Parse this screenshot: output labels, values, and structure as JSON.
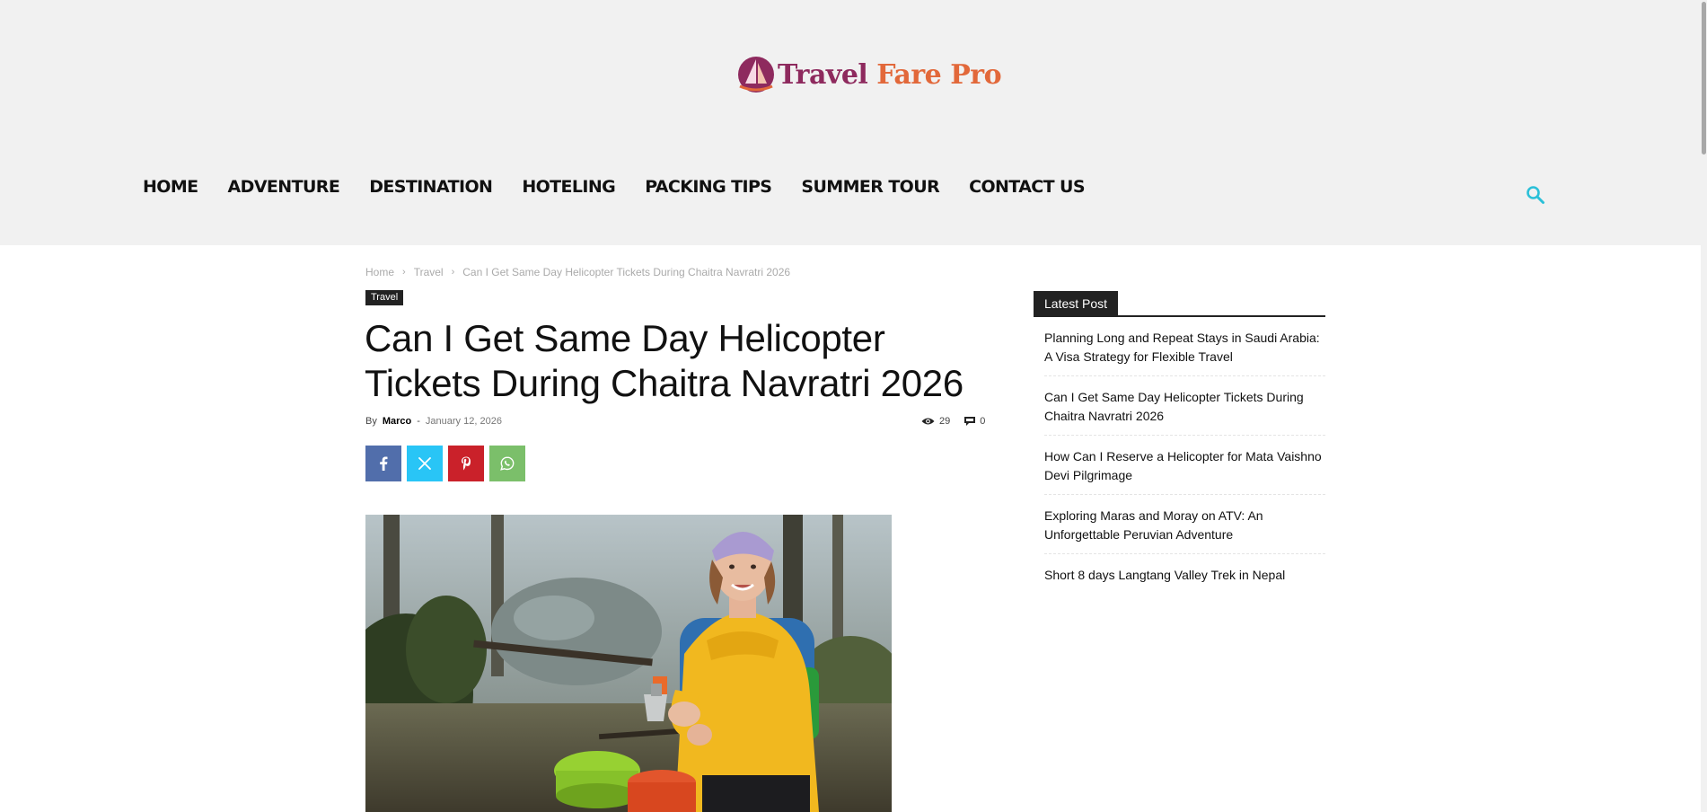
{
  "brand": {
    "word1": "Travel",
    "word2": "Fare Pro",
    "colors": {
      "primary": "#8e2a5e",
      "accent": "#e2683a"
    }
  },
  "nav": {
    "items": [
      "HOME",
      "ADVENTURE",
      "DESTINATION",
      "HOTELING",
      "PACKING TIPS",
      "SUMMER TOUR",
      "CONTACT US"
    ],
    "search_icon": "search-icon"
  },
  "breadcrumb": {
    "home": "Home",
    "category": "Travel",
    "current": "Can I Get Same Day Helicopter Tickets During Chaitra Navratri 2026"
  },
  "article": {
    "category": "Travel",
    "title": "Can I Get Same Day Helicopter Tickets During Chaitra Navratri 2026",
    "by": "By",
    "author": "Marco",
    "separator": "-",
    "date": "January 12, 2026",
    "views": "29",
    "comments": "0"
  },
  "share": [
    "facebook-icon",
    "x-icon",
    "pinterest-icon",
    "whatsapp-icon"
  ],
  "sidebar": {
    "heading": "Latest Post",
    "posts": [
      "Planning Long and Repeat Stays in Saudi Arabia: A Visa Strategy for Flexible Travel",
      "Can I Get Same Day Helicopter Tickets During Chaitra Navratri 2026",
      "How Can I Reserve a Helicopter for Mata Vaishno Devi Pilgrimage",
      "Exploring Maras and Moray on ATV: An Unforgettable Peruvian Adventure",
      "Short 8 days Langtang Valley Trek in Nepal"
    ]
  }
}
